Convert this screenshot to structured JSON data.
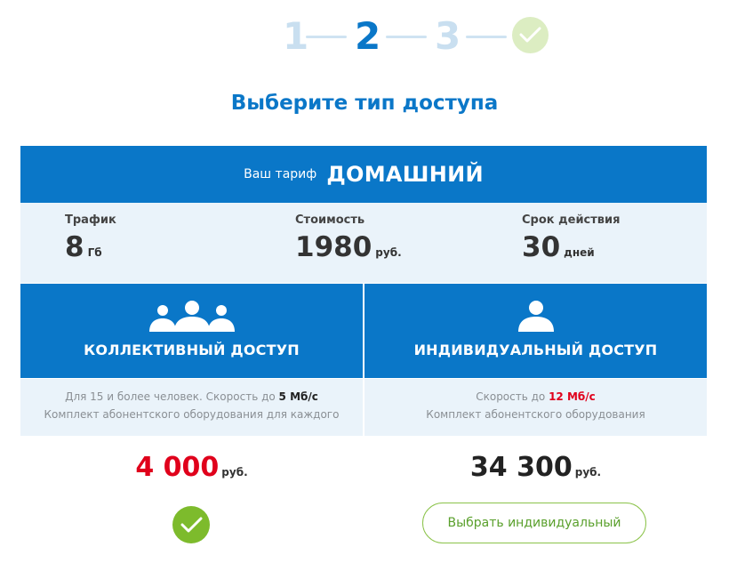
{
  "stepper": {
    "steps": [
      "1",
      "2",
      "3"
    ],
    "current": 2,
    "done_icon": "check-icon"
  },
  "page_title": "Выберите тип доступа",
  "tariff": {
    "label": "Ваш тариф",
    "name": "ДОМАШНИЙ",
    "traffic": {
      "caption": "Трафик",
      "value": "8",
      "unit": "Гб"
    },
    "cost": {
      "caption": "Стоимость",
      "value": "1980",
      "unit": "руб."
    },
    "validity": {
      "caption": "Срок действия",
      "value": "30",
      "unit": "дней"
    }
  },
  "options": [
    {
      "icon": "group-icon",
      "title": "КОЛЛЕКТИВНЫЙ ДОСТУП",
      "desc_prefix": "Для 15 и более человек. Скорость до ",
      "speed": "5 Мб/с",
      "desc_line2": "Комплект абонентского оборудования для каждого",
      "price": "4 000",
      "price_unit": "руб.",
      "selected": true
    },
    {
      "icon": "person-icon",
      "title": "ИНДИВИДУАЛЬНЫЙ ДОСТУП",
      "desc_prefix": "Скорость до ",
      "speed": "12 Мб/с",
      "desc_line2": "Комплект абонентского оборудования",
      "price": "34 300",
      "price_unit": "руб.",
      "button_label": "Выбрать индивидуальный"
    }
  ],
  "colors": {
    "primary": "#0a77c8",
    "light_bg": "#eaf3fa",
    "accent_red": "#e0001b",
    "accent_green": "#7dbb2c"
  }
}
